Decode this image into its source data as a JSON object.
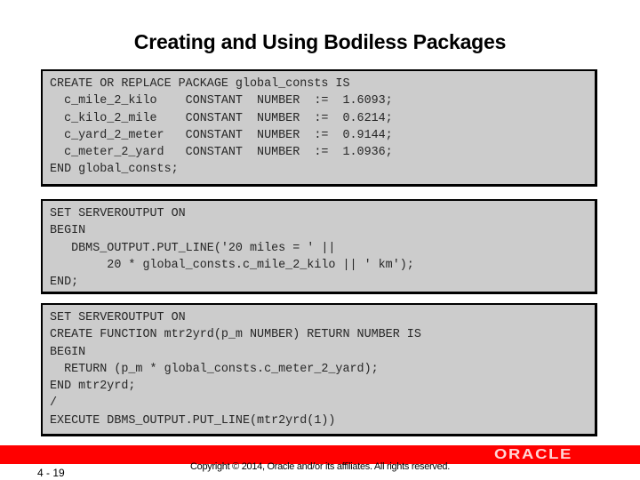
{
  "slide": {
    "title": "Creating and Using Bodiless Packages"
  },
  "code_blocks": [
    {
      "lines": [
        "CREATE OR REPLACE PACKAGE global_consts IS",
        "  c_mile_2_kilo    CONSTANT  NUMBER  :=  1.6093;",
        "  c_kilo_2_mile    CONSTANT  NUMBER  :=  0.6214;",
        "  c_yard_2_meter   CONSTANT  NUMBER  :=  0.9144;",
        "  c_meter_2_yard   CONSTANT  NUMBER  :=  1.0936;",
        "END global_consts;"
      ]
    },
    {
      "lines": [
        "SET SERVEROUTPUT ON",
        "BEGIN",
        "   DBMS_OUTPUT.PUT_LINE('20 miles = ' ||",
        "        20 * global_consts.c_mile_2_kilo || ' km');",
        "END;"
      ]
    },
    {
      "lines": [
        "SET SERVEROUTPUT ON",
        "CREATE FUNCTION mtr2yrd(p_m NUMBER) RETURN NUMBER IS",
        "BEGIN",
        "  RETURN (p_m * global_consts.c_meter_2_yard);",
        "END mtr2yrd;",
        "/",
        "EXECUTE DBMS_OUTPUT.PUT_LINE(mtr2yrd(1))"
      ]
    }
  ],
  "footer": {
    "logo_text": "ORACLE",
    "page_number": "4 - 19",
    "copyright": "Copyright © 2014, Oracle and/or its affiliates. All rights reserved.",
    "bar_color": "#ff0000"
  },
  "colors": {
    "code_background": "#cccccc",
    "code_border": "#000000"
  }
}
